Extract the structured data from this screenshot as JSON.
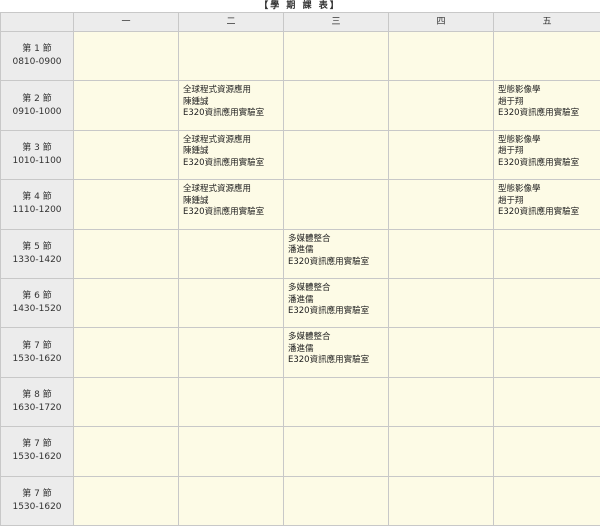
{
  "title": "【學 期 課 表】",
  "days": [
    "一",
    "二",
    "三",
    "四",
    "五"
  ],
  "periods": [
    {
      "label": "第 1 節",
      "time": "0810-0900",
      "slots": [
        null,
        null,
        null,
        null,
        null
      ]
    },
    {
      "label": "第 2 節",
      "time": "0910-1000",
      "slots": [
        null,
        {
          "course": "全球程式資源應用",
          "teacher": "陳鍾誠",
          "room": "E320資訊應用實驗室"
        },
        null,
        null,
        {
          "course": "型態影像學",
          "teacher": "趙于翔",
          "room": "E320資訊應用實驗室"
        }
      ]
    },
    {
      "label": "第 3 節",
      "time": "1010-1100",
      "slots": [
        null,
        {
          "course": "全球程式資源應用",
          "teacher": "陳鍾誠",
          "room": "E320資訊應用實驗室"
        },
        null,
        null,
        {
          "course": "型態影像學",
          "teacher": "趙于翔",
          "room": "E320資訊應用實驗室"
        }
      ]
    },
    {
      "label": "第 4 節",
      "time": "1110-1200",
      "slots": [
        null,
        {
          "course": "全球程式資源應用",
          "teacher": "陳鍾誠",
          "room": "E320資訊應用實驗室"
        },
        null,
        null,
        {
          "course": "型態影像學",
          "teacher": "趙于翔",
          "room": "E320資訊應用實驗室"
        }
      ]
    },
    {
      "label": "第 5 節",
      "time": "1330-1420",
      "slots": [
        null,
        null,
        {
          "course": "多媒體整合",
          "teacher": "潘進儒",
          "room": "E320資訊應用實驗室"
        },
        null,
        null
      ]
    },
    {
      "label": "第 6 節",
      "time": "1430-1520",
      "slots": [
        null,
        null,
        {
          "course": "多媒體整合",
          "teacher": "潘進儒",
          "room": "E320資訊應用實驗室"
        },
        null,
        null
      ]
    },
    {
      "label": "第 7 節",
      "time": "1530-1620",
      "slots": [
        null,
        null,
        {
          "course": "多媒體整合",
          "teacher": "潘進儒",
          "room": "E320資訊應用實驗室"
        },
        null,
        null
      ]
    },
    {
      "label": "第 8 節",
      "time": "1630-1720",
      "slots": [
        null,
        null,
        null,
        null,
        null
      ]
    },
    {
      "label": "第 7 節",
      "time": "1530-1620",
      "slots": [
        null,
        null,
        null,
        null,
        null
      ]
    },
    {
      "label": "第 7 節",
      "time": "1530-1620",
      "slots": [
        null,
        null,
        null,
        null,
        null
      ]
    }
  ]
}
